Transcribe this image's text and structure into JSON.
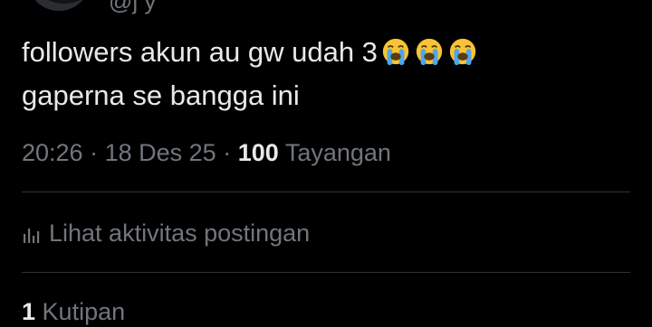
{
  "author": {
    "handle": "@j y"
  },
  "tweet": {
    "text_line1": "followers akun au gw udah 3",
    "text_line2": "gaperna se bangga ini",
    "emojis": [
      "loudly-crying-face-icon",
      "loudly-crying-face-icon",
      "loudly-crying-face-icon"
    ]
  },
  "meta": {
    "time": "20:26",
    "separator": "·",
    "date": "18 Des 25",
    "views_count": "100",
    "views_label": "Tayangan"
  },
  "actions": {
    "activity_label": "Lihat aktivitas postingan",
    "quotes_count": "1",
    "quotes_label": "Kutipan"
  },
  "colors": {
    "background": "#000000",
    "primary_text": "#e7e9ea",
    "secondary_text": "#71767b",
    "divider": "#2f3336",
    "emoji_face": "#f9c333",
    "emoji_tears": "#4aa8ee"
  }
}
